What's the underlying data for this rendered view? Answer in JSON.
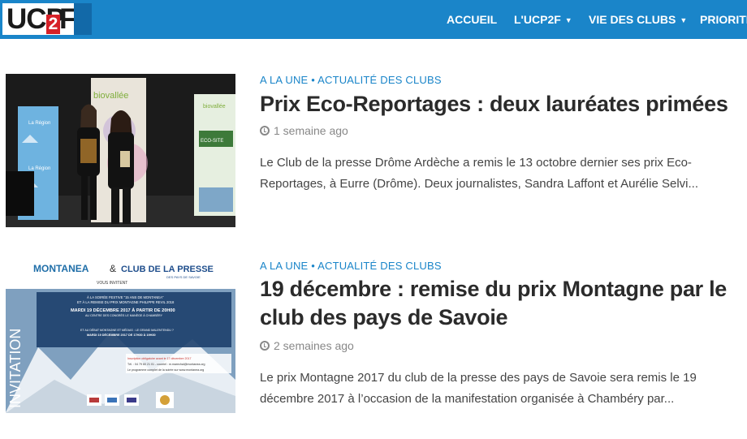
{
  "header": {
    "logo": {
      "text_left": "UCP",
      "text_mid": "2",
      "text_right": "F"
    },
    "nav": [
      {
        "label": "ACCUEIL",
        "has_dropdown": false
      },
      {
        "label": "L'UCP2F",
        "has_dropdown": true
      },
      {
        "label": "VIE DES CLUBS",
        "has_dropdown": true
      },
      {
        "label": "PRIORITÉ",
        "has_dropdown": false
      }
    ],
    "caret": "▼"
  },
  "articles": [
    {
      "categories": [
        "A LA UNE",
        "ACTUALITÉ DES CLUBS"
      ],
      "separator": "•",
      "title": "Prix Eco-Reportages : deux lauréates primées",
      "time": "1 semaine ago",
      "excerpt": "Le Club de la presse Drôme Ardèche a remis le 13 octobre dernier ses prix Eco-Reportages, à Eurre (Drôme). Deux journalistes, Sandra Laffont et Aurélie Selvi...",
      "image": {
        "banner_text": "biovallée",
        "poster_left": "La Région Auvergne-Rhône-Alpes",
        "poster_left_2": "La Région",
        "poster_right_1": "biovallée",
        "poster_right_2": "ECO-SITE"
      }
    },
    {
      "categories": [
        "A LA UNE",
        "ACTUALITÉ DES CLUBS"
      ],
      "separator": "•",
      "title": "19 décembre : remise du prix Montagne par le club des pays de Savoie",
      "time": "2 semaines ago",
      "excerpt": "Le prix Montagne 2017 du club de la presse des pays de Savoie sera remis le 19 décembre 2017 à l’occasion de la manifestation organisée à Chambéry par...",
      "image": {
        "logo_left": "MONTANEA",
        "amp": "&",
        "logo_right": "CLUB DE LA PRESSE",
        "logo_right_sub": "DES PAYS DE SAVOIE",
        "invite": "VOUS INVITENT",
        "vertical": "INVITATION",
        "line1": "À LA SOIRÉE FESTIVE \"15 ANS DE MONTANEA\"",
        "line2": "ET À LA REMISE DU PRIX MONTAGNE PHILIPPE REVIL 2018",
        "line3": "MARDI 19 DÉCEMBRE 2017 À PARTIR DE 20H00",
        "line4": "AU CENTRE DES CONGRÈS LE MANÈGE À CHAMBÉRY",
        "line5": "ET AU DÉBAT MONTAGNE ET MÉDIAS : LE GRAND MALENTENDU ?",
        "line6": "MARDI 19 DÉCEMBRE 2017 DE 17H30 À 19H30",
        "line7": "Inscription obligatoire avant le 17 décembre 2017",
        "line8": "Tél. : 04 79 60 21 01 - courriel : m.marechal@montanea.org",
        "line9": "Le programme complet de la soirée sur www.montanea.org"
      }
    }
  ],
  "colors": {
    "brand_blue": "#1a85c9",
    "logo_red": "#d62128",
    "title": "#2b2b2b",
    "meta": "#888888"
  }
}
